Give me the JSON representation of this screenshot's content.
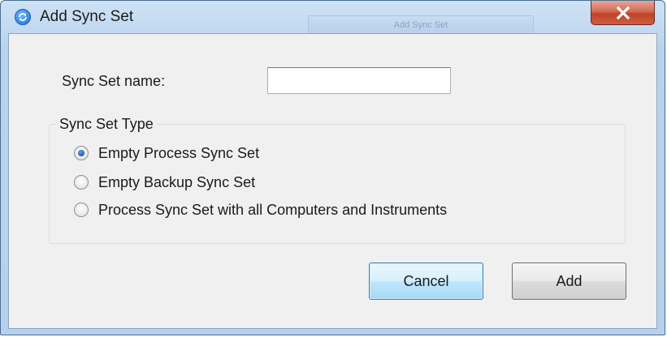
{
  "window": {
    "title": "Add Sync Set",
    "background_tab_label": "Add Sync Set"
  },
  "form": {
    "name_label": "Sync Set name:",
    "name_value": "",
    "group_title": "Sync Set Type",
    "options": [
      {
        "label": "Empty Process Sync Set",
        "checked": true
      },
      {
        "label": "Empty Backup Sync Set",
        "checked": false
      },
      {
        "label": "Process Sync Set with all Computers and Instruments",
        "checked": false
      }
    ]
  },
  "buttons": {
    "cancel": "Cancel",
    "add": "Add"
  },
  "icons": {
    "app": "sync-icon",
    "close": "close-icon"
  },
  "colors": {
    "titlebar": "#b9d3ee",
    "close_button": "#c8553b",
    "dialog_body": "#f0f0f0",
    "default_button": "#bee6fd"
  }
}
